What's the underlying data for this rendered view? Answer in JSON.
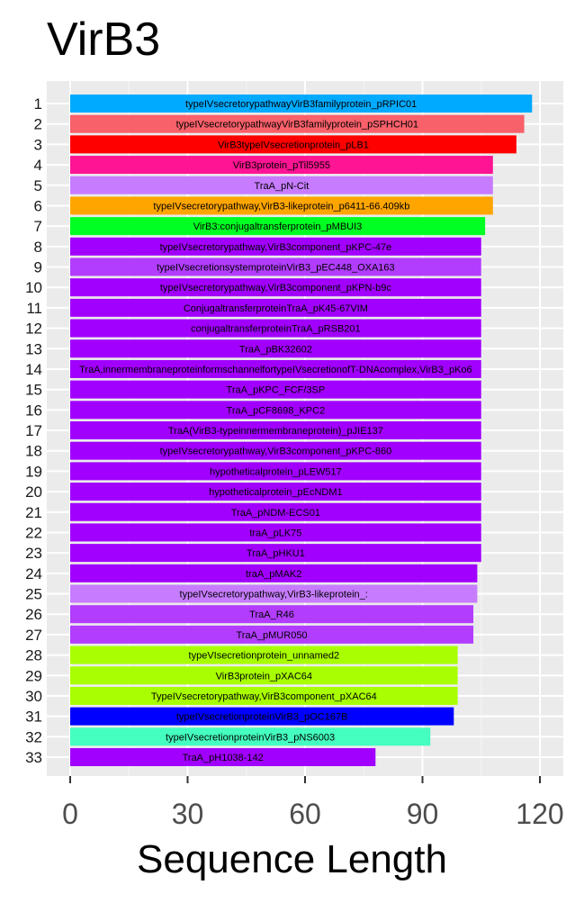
{
  "chart_data": {
    "type": "bar",
    "orientation": "horizontal",
    "title": "VirB3",
    "xlabel": "Sequence Length",
    "ylabel": "",
    "xlim": [
      -6,
      123
    ],
    "xticks": [
      0,
      30,
      60,
      90,
      120
    ],
    "grid": true,
    "legend": "none",
    "categories": [
      "1",
      "2",
      "3",
      "4",
      "5",
      "6",
      "7",
      "8",
      "9",
      "10",
      "11",
      "12",
      "13",
      "14",
      "15",
      "16",
      "17",
      "18",
      "19",
      "20",
      "21",
      "22",
      "23",
      "24",
      "25",
      "26",
      "27",
      "28",
      "29",
      "30",
      "31",
      "32",
      "33"
    ],
    "values": [
      118,
      116,
      114,
      108,
      108,
      108,
      106,
      105,
      105,
      105,
      105,
      105,
      105,
      105,
      105,
      105,
      105,
      105,
      105,
      105,
      105,
      105,
      105,
      104,
      104,
      103,
      103,
      99,
      99,
      99,
      98,
      92,
      78
    ],
    "bar_labels": [
      "typeIVsecretorypathwayVirB3familyprotein_pRPIC01",
      "typeIVsecretorypathwayVirB3familyprotein_pSPHCH01",
      "VirB3typeIVsecretionprotein_pLB1",
      "VirB3protein_pTil5955",
      "TraA_pN-Cit",
      "typeIVsecretorypathway,VirB3-likeprotein_p6411-66.409kb",
      "VirB3:conjugaltransferprotein_pMBUI3",
      "typeIVsecretorypathway,VirB3component_pKPC-47e",
      "typeIVsecretionsystemproteinVirB3_pEC448_OXA163",
      "typeIVsecretorypathway,VirB3component_pKPN-b9c",
      "ConjugaltransferproteinTraA_pK45-67VIM",
      "conjugaltransferproteinTraA_pRSB201",
      "TraA_pBK32602",
      "TraA,innermembraneproteinformschannelfortypeIVsecretionofT-DNAcomplex,VirB3_pKo6",
      "TraA_pKPC_FCF/3SP",
      "TraA_pCF8698_KPC2",
      "TraA(VirB3-typeinnermembraneprotein)_pJIE137",
      "typeIVsecretorypathway,VirB3component_pKPC-860",
      "hypotheticalprotein_pLEW517",
      "hypotheticalprotein_pEcNDM1",
      "TraA_pNDM-ECS01",
      "traA_pLK75",
      "TraA_pHKU1",
      "traA_pMAK2",
      "typeIVsecretorypathway,VirB3-likeprotein_:",
      "TraA_R46",
      "TraA_pMUR050",
      "typeVIsecretionprotein_unnamed2",
      "VirB3protein_pXAC64",
      "TypeIVsecretorypathway,VirB3component_pXAC64",
      "typeIVsecretionproteinVirB3_pOC167B",
      "typeIVsecretionproteinVirB3_pNS6003",
      "TraA_pH1038-142"
    ],
    "colors": [
      "#00aaff",
      "#f8606a",
      "#ff0000",
      "#ff1493",
      "#c77cff",
      "#ffa500",
      "#00ff22",
      "#a100ff",
      "#b23dff",
      "#a100ff",
      "#a100ff",
      "#a100ff",
      "#a100ff",
      "#a100ff",
      "#a100ff",
      "#a100ff",
      "#a100ff",
      "#a100ff",
      "#a100ff",
      "#a100ff",
      "#a100ff",
      "#a100ff",
      "#a100ff",
      "#a100ff",
      "#c77cff",
      "#b23dff",
      "#b23dff",
      "#a8ff00",
      "#a8ff00",
      "#a8ff00",
      "#0000ff",
      "#44ffc0",
      "#a100ff"
    ]
  },
  "style": {
    "panel_bg": "#ebebeb",
    "grid_major": "#ffffff",
    "grid_minor": "#f5f5f5"
  }
}
